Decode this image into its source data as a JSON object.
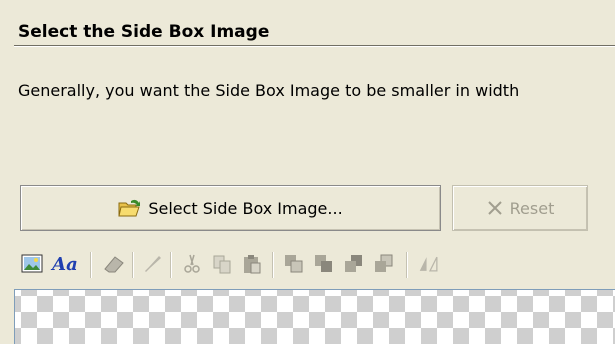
{
  "section": {
    "title": "Select the Side Box Image",
    "description": "Generally, you want the Side Box Image to be smaller in width"
  },
  "buttons": {
    "select_label": "Select Side Box Image...",
    "reset_label": "Reset"
  },
  "toolbar": {
    "icons": [
      "image-icon",
      "font-icon",
      "eraser-icon",
      "brush-icon",
      "cut-icon",
      "copy-icon",
      "paste-icon",
      "layer-front-icon",
      "layer-forward-icon",
      "layer-backward-icon",
      "layer-back-icon",
      "flip-icon"
    ],
    "font_icon_text": "Aa"
  },
  "colors": {
    "background": "#ece9d8",
    "accent_blue": "#1f3fb0",
    "disabled_text": "#a19e8f"
  }
}
